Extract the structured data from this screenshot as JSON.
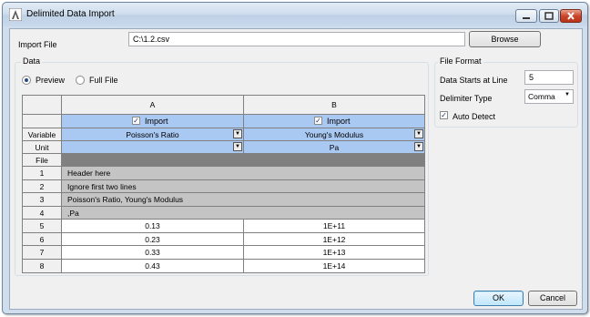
{
  "window": {
    "title": "Delimited Data Import",
    "icon": "app-logo-icon"
  },
  "import_file": {
    "label": "Import File",
    "value": "C:\\1.2.csv",
    "browse_label": "Browse"
  },
  "data_group": {
    "title": "Data",
    "preview_label": "Preview",
    "full_file_label": "Full File",
    "selected": "Preview"
  },
  "grid": {
    "columns": [
      {
        "letter": "A",
        "import_label": "Import",
        "import_checked": true,
        "variable": "Poisson's Ratio",
        "unit": ""
      },
      {
        "letter": "B",
        "import_label": "Import",
        "import_checked": true,
        "variable": "Young's Modulus",
        "unit": "Pa"
      }
    ],
    "row_labels": {
      "variable": "Variable",
      "unit": "Unit",
      "file": "File"
    },
    "rows": [
      {
        "num": "1",
        "text": "Header here"
      },
      {
        "num": "2",
        "text": "Ignore first two lines"
      },
      {
        "num": "3",
        "text": "Poisson's Ratio, Young's Modulus"
      },
      {
        "num": "4",
        "text": ",Pa"
      },
      {
        "num": "5",
        "a": "0.13",
        "b": "1E+11"
      },
      {
        "num": "6",
        "a": "0.23",
        "b": "1E+12"
      },
      {
        "num": "7",
        "a": "0.33",
        "b": "1E+13"
      },
      {
        "num": "8",
        "a": "0.43",
        "b": "1E+14"
      }
    ]
  },
  "file_format": {
    "title": "File Format",
    "start_line_label": "Data Starts at Line",
    "start_line_value": "5",
    "delimiter_label": "Delimiter Type",
    "delimiter_value": "Comma",
    "auto_detect_label": "Auto Detect",
    "auto_detect_checked": true
  },
  "footer": {
    "ok_label": "OK",
    "cancel_label": "Cancel"
  }
}
